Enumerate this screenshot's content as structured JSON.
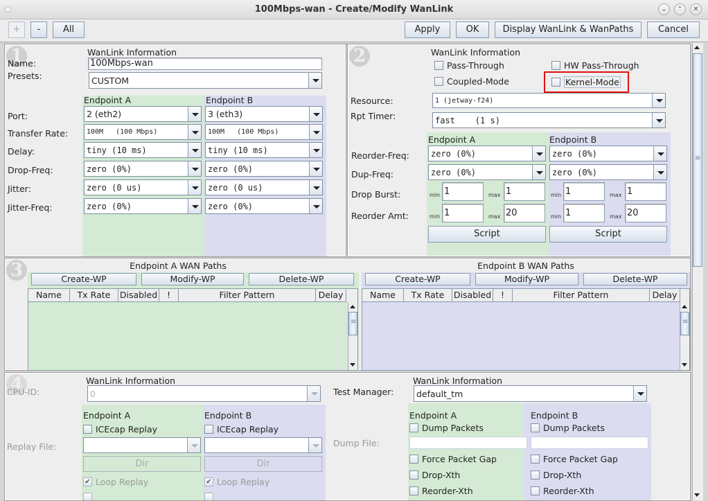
{
  "window": {
    "title": "100Mbps-wan - Create/Modify WanLink",
    "controls": [
      "minimize",
      "maximize",
      "close"
    ]
  },
  "toolbar": {
    "plus_label": "+",
    "minus_label": "-",
    "all_label": "All",
    "apply_label": "Apply",
    "ok_label": "OK",
    "display_label": "Display WanLink & WanPaths",
    "cancel_label": "Cancel"
  },
  "section1": {
    "number": "1",
    "header": "WanLink Information",
    "name_label": "Name:",
    "name_value": "100Mbps-wan",
    "presets_label": "Presets:",
    "presets_value": "CUSTOM",
    "endpoint_a": "Endpoint A",
    "endpoint_b": "Endpoint B",
    "rows": [
      {
        "label": "Port:",
        "a": "2 (eth2)",
        "b": "3 (eth3)"
      },
      {
        "label": "Transfer Rate:",
        "a": "100M   (100 Mbps)",
        "b": "100M   (100 Mbps)"
      },
      {
        "label": "Delay:",
        "a": "tiny (10 ms)",
        "b": "tiny (10 ms)"
      },
      {
        "label": "Drop-Freq:",
        "a": "zero (0%)",
        "b": "zero (0%)"
      },
      {
        "label": "Jitter:",
        "a": "zero (0 us)",
        "b": "zero (0 us)"
      },
      {
        "label": "Jitter-Freq:",
        "a": "zero (0%)",
        "b": "zero (0%)"
      }
    ]
  },
  "section2": {
    "number": "2",
    "header": "WanLink Information",
    "checkboxes": {
      "pass_through": {
        "label": "Pass-Through",
        "checked": false
      },
      "hw_pass_through": {
        "label": "HW Pass-Through",
        "checked": false
      },
      "coupled_mode": {
        "label": "Coupled-Mode",
        "checked": false
      },
      "kernel_mode": {
        "label": "Kernel-Mode",
        "checked": false
      }
    },
    "resource_label": "Resource:",
    "resource_value": "1 (jetway-f24)",
    "rpt_timer_label": "Rpt Timer:",
    "rpt_timer_value": "fast    (1 s)",
    "endpoint_a": "Endpoint A",
    "endpoint_b": "Endpoint B",
    "reorder_freq_label": "Reorder-Freq:",
    "reorder_freq_a": "zero (0%)",
    "reorder_freq_b": "zero (0%)",
    "dup_freq_label": "Dup-Freq:",
    "dup_freq_a": "zero (0%)",
    "dup_freq_b": "zero (0%)",
    "drop_burst_label": "Drop Burst:",
    "reorder_amt_label": "Reorder Amt:",
    "min_label": "min",
    "max_label": "max",
    "drop_burst_a": {
      "min": "1",
      "max": "1"
    },
    "drop_burst_b": {
      "min": "1",
      "max": "1"
    },
    "reorder_amt_a": {
      "min": "1",
      "max": "20"
    },
    "reorder_amt_b": {
      "min": "1",
      "max": "20"
    },
    "script_label": "Script"
  },
  "section3": {
    "number": "3",
    "a_title": "Endpoint A WAN Paths",
    "b_title": "Endpoint B WAN Paths",
    "create_label": "Create-WP",
    "modify_label": "Modify-WP",
    "delete_label": "Delete-WP",
    "columns": [
      "Name",
      "Tx Rate",
      "Disabled",
      "!",
      "Filter Pattern",
      "Delay"
    ],
    "a_rows": [],
    "b_rows": []
  },
  "section4": {
    "number": "4",
    "left_header": "WanLink Information",
    "cpu_id_label": "CPU-ID:",
    "cpu_id_value": "0",
    "endpoint_a": "Endpoint A",
    "endpoint_b": "Endpoint B",
    "icecap_label": "ICEcap Replay",
    "replay_file_label": "Replay File:",
    "dir_label": "Dir",
    "loop_replay_label": "Loop Replay",
    "right_header": "WanLink Information",
    "test_manager_label": "Test Manager:",
    "test_manager_value": "default_tm",
    "dump_packets_label": "Dump Packets",
    "dump_file_label": "Dump File:",
    "dump_file_a": "",
    "dump_file_b": "",
    "force_gap_label": "Force Packet Gap",
    "drop_xth_label": "Drop-Xth",
    "reorder_xth_label": "Reorder-Xth"
  },
  "colors": {
    "endpoint_a_bg": "#d4ead4",
    "endpoint_b_bg": "#dcdcf0",
    "highlight": "#e01010"
  }
}
